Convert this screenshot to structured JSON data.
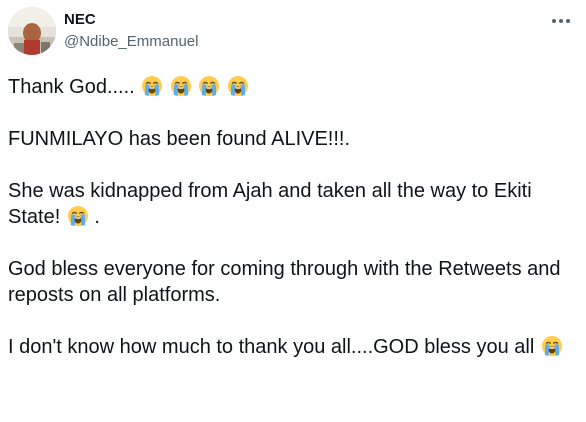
{
  "tweet": {
    "display_name": "NEC",
    "handle": "@Ndibe_Emmanuel",
    "avatar_icon": "profile-photo",
    "more_icon": "more-horizontal-icon",
    "paragraphs": [
      {
        "text": "Thank God.....",
        "emoji_after": 4
      },
      {
        "text": "FUNMILAYO has been found ALIVE!!!.",
        "emoji_after": 0
      },
      {
        "text": "She was kidnapped from Ajah and taken all the way to Ekiti State!",
        "emoji_after": 1,
        "suffix": "."
      },
      {
        "text": "God bless everyone for coming through with the Retweets and reposts on all platforms.",
        "emoji_after": 0
      },
      {
        "text": "I don't know how much to thank you all....GOD bless you all",
        "emoji_after": 1
      }
    ],
    "emoji_name": "loudly-crying-face-emoji"
  },
  "colors": {
    "text": "#0f1419",
    "secondary": "#536471",
    "emoji_face": "#ffcc4d",
    "emoji_tears": "#5dadec"
  }
}
